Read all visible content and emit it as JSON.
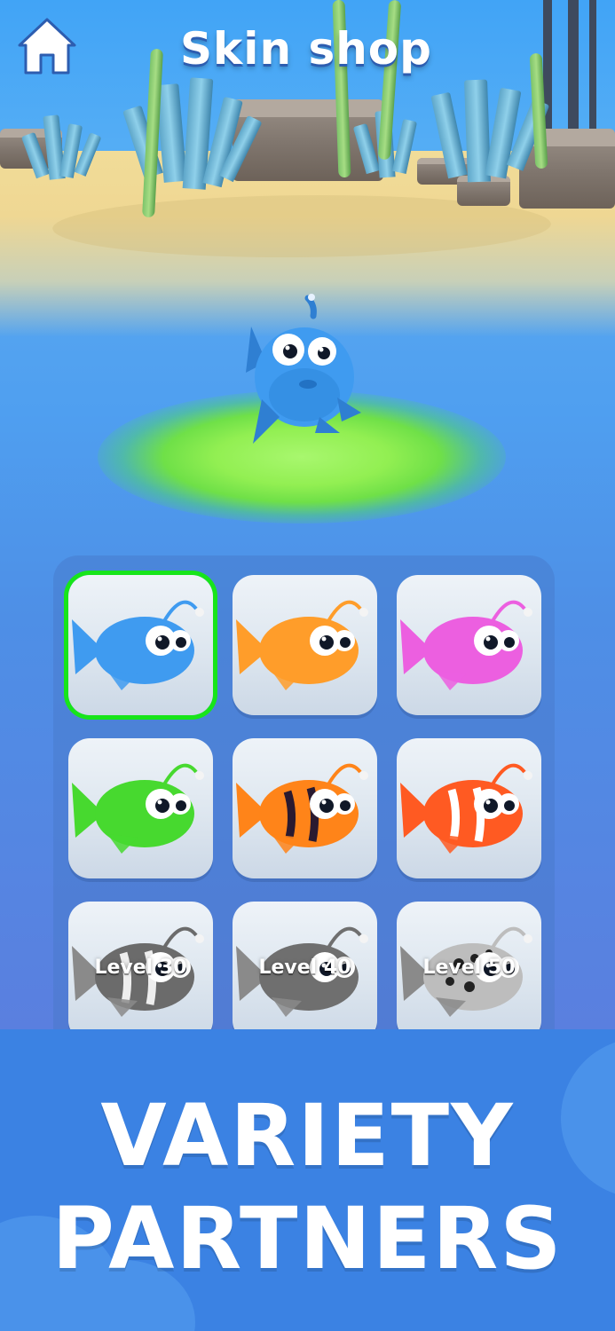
{
  "header": {
    "title": "Skin shop",
    "home_icon": "home-icon"
  },
  "hero": {
    "selected_skin_color": "#3f9bf0"
  },
  "skins": [
    {
      "name": "blue",
      "color": "#3f9bf0",
      "state": "selected",
      "lock_label": ""
    },
    {
      "name": "orange",
      "color": "#ff9d2a",
      "state": "owned",
      "lock_label": ""
    },
    {
      "name": "pink",
      "color": "#ec5fe0",
      "state": "owned",
      "lock_label": ""
    },
    {
      "name": "green",
      "color": "#47d92f",
      "state": "owned",
      "lock_label": ""
    },
    {
      "name": "tiger-orange",
      "color": "#ff8419",
      "state": "owned",
      "lock_label": ""
    },
    {
      "name": "clown-red",
      "color": "#ff5a22",
      "state": "owned",
      "lock_label": ""
    },
    {
      "name": "locked-striped",
      "color": "#6b6b6b",
      "state": "locked",
      "lock_label": "Level 30"
    },
    {
      "name": "locked-grey",
      "color": "#6f6f6f",
      "state": "locked",
      "lock_label": "Level 40"
    },
    {
      "name": "locked-spotted",
      "color": "#bdbdbd",
      "state": "locked",
      "lock_label": "Level 50"
    }
  ],
  "banner": {
    "line1": "VARIETY",
    "line2": "PARTNERS"
  },
  "colors": {
    "selected_border": "#17e51a",
    "banner_bg": "#3b82e3"
  }
}
